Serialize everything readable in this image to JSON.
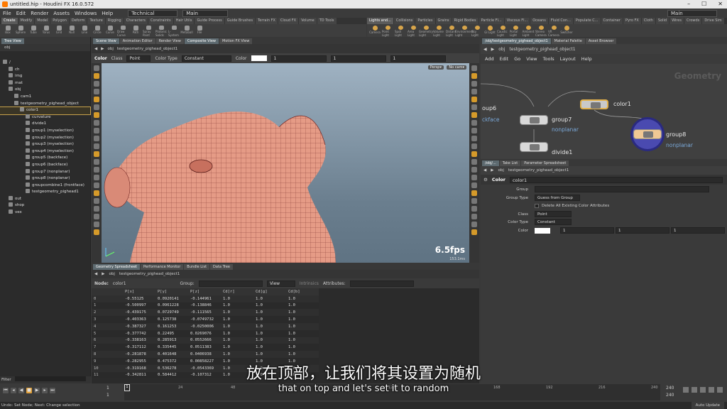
{
  "window": {
    "title": "untitled.hip - Houdini FX 16.0.572",
    "controls": [
      "–",
      "☐",
      "✕"
    ]
  },
  "menu": {
    "items": [
      "File",
      "Edit",
      "Render",
      "Assets",
      "Windows",
      "Help"
    ],
    "desktop": "Technical",
    "build": "Main",
    "desktop_right": "Main"
  },
  "shelf_left": {
    "tabs": [
      "Create",
      "Modify",
      "Model",
      "Polygon",
      "Deform",
      "Texture",
      "Rigging",
      "Characters",
      "Constraints",
      "Hair Utils",
      "Guide Process",
      "Guide Brushes",
      "Terrain FX",
      "Cloud FX",
      "Volume",
      "TD Tools"
    ],
    "tools": [
      "Box",
      "Sphere",
      "Tube",
      "Torus",
      "Grid",
      "Null",
      "Line",
      "Circle",
      "Curve",
      "Draw Curve",
      "Path",
      "Spray Paint",
      "Platonic Solids",
      "L-System",
      "Metaball",
      "File"
    ]
  },
  "shelf_right": {
    "tabs": [
      "Lights and...",
      "Collisions",
      "Particles",
      "Grains",
      "Rigid Bodies",
      "Particle Fl...",
      "Viscous Fl...",
      "Oceans",
      "Fluid Con...",
      "Populate C...",
      "Container",
      "Pyro FX",
      "Cloth",
      "Solid",
      "Wires",
      "Crowds",
      "Drive Sim"
    ],
    "tools": [
      "Camera",
      "Point Light",
      "Spot Light",
      "Area Light",
      "Geometry Light",
      "Volume Light",
      "Distant Light",
      "Environment Light",
      "Sky Light",
      "GI Light",
      "Caustic Light",
      "Portal Light",
      "Ambient Light",
      "Stereo Camera",
      "VR Camera",
      "Switcher"
    ]
  },
  "tree": {
    "tabs": [
      "Tree View"
    ],
    "path": "obj",
    "rows": [
      {
        "label": "/",
        "indent": 0
      },
      {
        "label": "ch",
        "indent": 1
      },
      {
        "label": "img",
        "indent": 1
      },
      {
        "label": "mat",
        "indent": 1
      },
      {
        "label": "obj",
        "indent": 1
      },
      {
        "label": "cam1",
        "indent": 2
      },
      {
        "label": "testgeometry_pighead_object",
        "indent": 2
      },
      {
        "label": "color1",
        "indent": 3,
        "selected": true
      },
      {
        "label": "curvature",
        "indent": 4
      },
      {
        "label": "divide1",
        "indent": 4
      },
      {
        "label": "group1 (myselection)",
        "indent": 4
      },
      {
        "label": "group2 (myselection)",
        "indent": 4
      },
      {
        "label": "group3 (myselection)",
        "indent": 4
      },
      {
        "label": "group4 (myselection)",
        "indent": 4
      },
      {
        "label": "group5 (backface)",
        "indent": 4
      },
      {
        "label": "group6 (backface)",
        "indent": 4
      },
      {
        "label": "group7 (nonplanar)",
        "indent": 4
      },
      {
        "label": "group8 (nonplanar)",
        "indent": 4
      },
      {
        "label": "groupcombine1 (frontface)",
        "indent": 4
      },
      {
        "label": "testgeometry_pighead1",
        "indent": 4
      },
      {
        "label": "out",
        "indent": 1
      },
      {
        "label": "shop",
        "indent": 1
      },
      {
        "label": "vex",
        "indent": 1
      }
    ],
    "filter_label": "Filter"
  },
  "viewport": {
    "tabs": [
      "Scene View",
      "Animation Editor",
      "Render View",
      "Composite View",
      "Motion FX View"
    ],
    "path_obj": "obj",
    "path_node": "testgeometry_pighead_object1",
    "tool": "Color",
    "class_label": "Class",
    "class_value": "Point",
    "color_type_label": "Color Type",
    "color_type_value": "Constant",
    "color_label": "Color",
    "color_values": [
      "1",
      "1",
      "1"
    ],
    "persp": "Persp▾",
    "cam": "No cam▾",
    "fps": "6.5fps",
    "ms": "153.1ms"
  },
  "spreadsheet": {
    "tabs": [
      "Geometry Spreadsheet",
      "Performance Monitor",
      "Bundle List",
      "Data Tree"
    ],
    "path_obj": "obj",
    "path_node": "testgeometry_pighead_object1",
    "node_label": "Node:",
    "node_value": "color1",
    "group_label": "Group:",
    "view_label": "View",
    "intrinsics_label": "Intrinsics",
    "attributes_label": "Attributes:",
    "columns": [
      "",
      "P[x]",
      "P[y]",
      "P[z]",
      "Cd[r]",
      "Cd[g]",
      "Cd[b]"
    ],
    "rows": [
      [
        "0",
        "-0.55125",
        "0.0920141",
        "-0.144961",
        "1.0",
        "1.0",
        "1.0"
      ],
      [
        "1",
        "-0.500997",
        "0.0961228",
        "-0.138846",
        "1.0",
        "1.0",
        "1.0"
      ],
      [
        "2",
        "-0.439175",
        "0.0729749",
        "-0.111565",
        "1.0",
        "1.0",
        "1.0"
      ],
      [
        "3",
        "-0.403363",
        "0.125738",
        "-0.0749732",
        "1.0",
        "1.0",
        "1.0"
      ],
      [
        "4",
        "-0.387327",
        "0.161253",
        "-0.0250006",
        "1.0",
        "1.0",
        "1.0"
      ],
      [
        "5",
        "-0.377742",
        "0.22495",
        "0.0269076",
        "1.0",
        "1.0",
        "1.0"
      ],
      [
        "6",
        "-0.338163",
        "0.285913",
        "0.0552666",
        "1.0",
        "1.0",
        "1.0"
      ],
      [
        "7",
        "-0.317112",
        "0.335445",
        "0.0511383",
        "1.0",
        "1.0",
        "1.0"
      ],
      [
        "8",
        "-0.281878",
        "0.401648",
        "0.0406938",
        "1.0",
        "1.0",
        "1.0"
      ],
      [
        "9",
        "-0.282955",
        "0.475372",
        "0.00858227",
        "1.0",
        "1.0",
        "1.0"
      ],
      [
        "10",
        "-0.319168",
        "0.536278",
        "-0.0543369",
        "1.0",
        "1.0",
        "1.0"
      ],
      [
        "11",
        "-0.342811",
        "0.584412",
        "-0.107312",
        "1.0",
        "1.0",
        "1.0"
      ]
    ]
  },
  "network": {
    "tabs": [
      "/obj/testgeometry_pighead_object1",
      "Material Palette",
      "Asset Browser"
    ],
    "path_obj": "obj",
    "path_node": "testgeometry_pighead_object1",
    "menu": [
      "Add",
      "Edit",
      "Go",
      "View",
      "Tools",
      "Layout",
      "Help"
    ],
    "watermark": "Geometry",
    "nodes": [
      {
        "name": "color1",
        "sub": ""
      },
      {
        "name": "group7",
        "sub": "nonplanar"
      },
      {
        "name": "group8",
        "sub": "nonplanar"
      },
      {
        "name": "divide1",
        "sub": ""
      },
      {
        "name": "oup6",
        "sub": "ckface"
      }
    ]
  },
  "params": {
    "tabs": [
      "/obj/...",
      "Take List",
      "Parameter Spreadsheet"
    ],
    "path_obj": "obj",
    "path_node": "testgeometry_pighead_object1",
    "node_type": "Color",
    "node_name": "color1",
    "rows": [
      {
        "label": "Group",
        "value": ""
      },
      {
        "label": "Group Type",
        "value": "Guess from Group"
      },
      {
        "label": "",
        "value": "Delete All Existing Color Attributes"
      },
      {
        "label": "Class",
        "value": "Point"
      },
      {
        "label": "Color Type",
        "value": "Constant"
      },
      {
        "label": "Color",
        "value": ""
      }
    ],
    "color_values": [
      "1",
      "1",
      "1"
    ]
  },
  "timeline": {
    "current_frame": "1",
    "start": "1",
    "start2": "1",
    "end": "240",
    "end2": "240",
    "ticks": [
      "1",
      "24",
      "48",
      "72",
      "96",
      "120",
      "144",
      "168",
      "192",
      "216",
      "240"
    ]
  },
  "status": {
    "text": "Undo: Set Node; Next: Change selection",
    "auto_update": "Auto Update"
  },
  "subtitles": {
    "zh": "放在顶部，让我们将其设置为随机",
    "en": "that on top and let's set it to random"
  }
}
